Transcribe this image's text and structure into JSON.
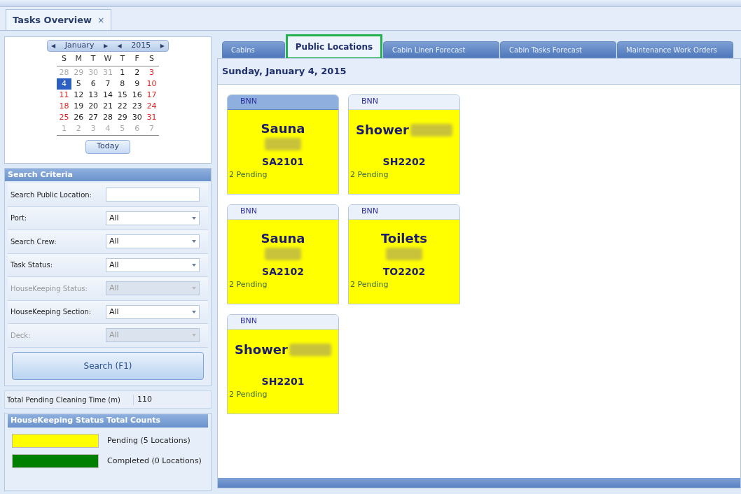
{
  "doc_tab": {
    "title": "Tasks Overview",
    "close": "×"
  },
  "calendar": {
    "month": "January",
    "year": "2015",
    "prev": "◀",
    "next": "▶",
    "weekdays": [
      "S",
      "M",
      "T",
      "W",
      "T",
      "F",
      "S"
    ],
    "weeks": [
      [
        {
          "d": "28",
          "kind": "muted",
          "selected": false
        },
        {
          "d": "29",
          "kind": "muted",
          "selected": false
        },
        {
          "d": "30",
          "kind": "muted",
          "selected": false
        },
        {
          "d": "31",
          "kind": "muted",
          "selected": false
        },
        {
          "d": "1",
          "kind": "normal",
          "selected": false
        },
        {
          "d": "2",
          "kind": "normal",
          "selected": false
        },
        {
          "d": "3",
          "kind": "weekend",
          "selected": false
        }
      ],
      [
        {
          "d": "4",
          "selected": true
        },
        {
          "d": "5",
          "kind": "normal",
          "selected": false
        },
        {
          "d": "6",
          "kind": "normal",
          "selected": false
        },
        {
          "d": "7",
          "kind": "normal",
          "selected": false
        },
        {
          "d": "8",
          "kind": "normal",
          "selected": false
        },
        {
          "d": "9",
          "kind": "normal",
          "selected": false
        },
        {
          "d": "10",
          "kind": "weekend",
          "selected": false
        }
      ],
      [
        {
          "d": "11",
          "kind": "weekend",
          "selected": false
        },
        {
          "d": "12",
          "kind": "normal",
          "selected": false
        },
        {
          "d": "13",
          "kind": "normal",
          "selected": false
        },
        {
          "d": "14",
          "kind": "normal",
          "selected": false
        },
        {
          "d": "15",
          "kind": "normal",
          "selected": false
        },
        {
          "d": "16",
          "kind": "normal",
          "selected": false
        },
        {
          "d": "17",
          "kind": "weekend",
          "selected": false
        }
      ],
      [
        {
          "d": "18",
          "kind": "weekend",
          "selected": false
        },
        {
          "d": "19",
          "kind": "normal",
          "selected": false
        },
        {
          "d": "20",
          "kind": "normal",
          "selected": false
        },
        {
          "d": "21",
          "kind": "normal",
          "selected": false
        },
        {
          "d": "22",
          "kind": "normal",
          "selected": false
        },
        {
          "d": "23",
          "kind": "normal",
          "selected": false
        },
        {
          "d": "24",
          "kind": "weekend",
          "selected": false
        }
      ],
      [
        {
          "d": "25",
          "kind": "weekend",
          "selected": false
        },
        {
          "d": "26",
          "kind": "normal",
          "selected": false
        },
        {
          "d": "27",
          "kind": "normal",
          "selected": false
        },
        {
          "d": "28",
          "kind": "normal",
          "selected": false
        },
        {
          "d": "29",
          "kind": "normal",
          "selected": false
        },
        {
          "d": "30",
          "kind": "normal",
          "selected": false
        },
        {
          "d": "31",
          "kind": "weekend",
          "selected": false
        }
      ],
      [
        {
          "d": "1",
          "kind": "muted",
          "selected": false
        },
        {
          "d": "2",
          "kind": "muted",
          "selected": false
        },
        {
          "d": "3",
          "kind": "muted",
          "selected": false
        },
        {
          "d": "4",
          "kind": "muted",
          "selected": false
        },
        {
          "d": "5",
          "kind": "muted",
          "selected": false
        },
        {
          "d": "6",
          "kind": "muted",
          "selected": false
        },
        {
          "d": "7",
          "kind": "muted",
          "selected": false
        }
      ]
    ],
    "today_button": "Today"
  },
  "search_criteria": {
    "title": "Search Criteria",
    "fields": [
      {
        "label": "Search Public Location:",
        "kind": "text",
        "disabled": false
      },
      {
        "label": "Port:",
        "kind": "select",
        "value": "All",
        "disabled": false
      },
      {
        "label": "Search Crew:",
        "kind": "select",
        "value": "All",
        "disabled": false
      },
      {
        "label": "Task Status:",
        "kind": "select",
        "value": "All",
        "disabled": false
      },
      {
        "label": "HouseKeeping Status:",
        "kind": "select",
        "value": "All",
        "disabled": true
      },
      {
        "label": "HouseKeeping Section:",
        "kind": "select",
        "value": "All",
        "disabled": false
      },
      {
        "label": "Deck:",
        "kind": "select",
        "value": "All",
        "disabled": true
      }
    ],
    "search_button": "Search (F1)"
  },
  "total_pending": {
    "label": "Total Pending Cleaning Time (m)",
    "value": "110"
  },
  "status_counts": {
    "title": "HouseKeeping Status Total Counts",
    "items": [
      {
        "label": "Pending (5 Locations)",
        "color": "#ffff00"
      },
      {
        "label": "Completed (0 Locations)",
        "color": "#008000"
      }
    ]
  },
  "tabs": [
    {
      "label": "Cabins",
      "selected": false
    },
    {
      "label": "Public Locations",
      "selected": true
    },
    {
      "label": "Cabin Linen Forecast",
      "selected": false
    },
    {
      "label": "Cabin Tasks Forecast",
      "selected": false
    },
    {
      "label": "Maintenance Work Orders",
      "selected": false
    }
  ],
  "date_heading": "Sunday, January 4, 2015",
  "cards": [
    {
      "header": "BNN",
      "name": "Sauna",
      "kind": "stacked",
      "code": "SA2101",
      "pending": "2 Pending",
      "color": "#ffff00",
      "selected": true
    },
    {
      "header": "BNN",
      "name": "Shower",
      "kind": "inline",
      "code": "SH2202",
      "pending": "2 Pending",
      "color": "#ffff00",
      "selected": false
    },
    {
      "header": "BNN",
      "name": "Sauna",
      "kind": "stacked",
      "code": "SA2102",
      "pending": "2 Pending",
      "color": "#ffff00",
      "selected": false
    },
    {
      "header": "BNN",
      "name": "Toilets",
      "kind": "stacked",
      "code": "TO2202",
      "pending": "2 Pending",
      "color": "#ffff00",
      "selected": false
    },
    {
      "header": "BNN",
      "name": "Shower",
      "kind": "inline",
      "code": "SH2201",
      "pending": "2 Pending",
      "color": "#ffff00",
      "selected": false
    }
  ]
}
